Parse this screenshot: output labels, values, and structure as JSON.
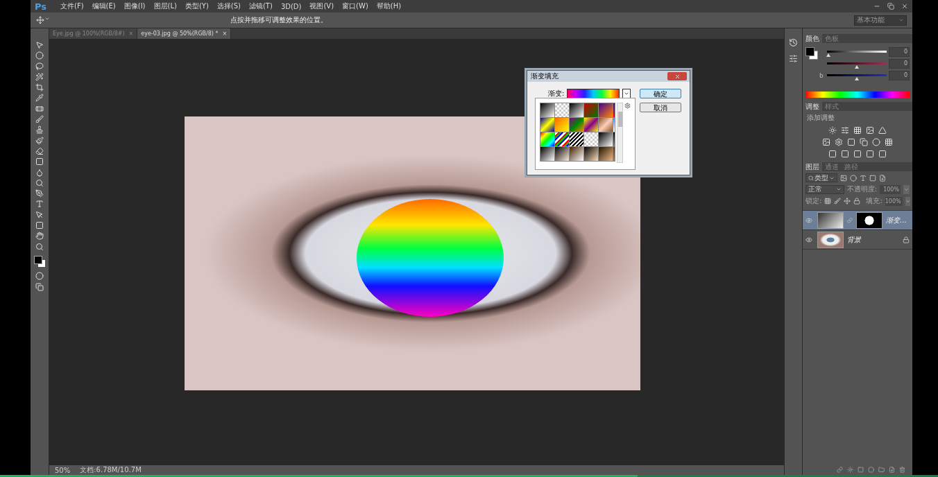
{
  "menu_bar": {
    "app_logo": "Ps",
    "items": [
      "文件(F)",
      "编辑(E)",
      "图像(I)",
      "图层(L)",
      "类型(Y)",
      "选择(S)",
      "滤镜(T)",
      "3D(D)",
      "视图(V)",
      "窗口(W)",
      "帮助(H)"
    ],
    "workspace": "基本功能"
  },
  "options_bar": {
    "hint": "点按并拖移可调整效果的位置。"
  },
  "document_tabs": [
    {
      "label": "Eye.jpg @ 100%(RGB/8#)",
      "selected": false,
      "close": "×"
    },
    {
      "label": "eye-03.jpg @ 50%(RGB/8) *",
      "selected": true,
      "close": "×"
    }
  ],
  "gradient_fill_dialog": {
    "title": "渐变填充",
    "gradient_label": "渐变:",
    "buttons": [
      {
        "label": "确定",
        "default": true
      },
      {
        "label": "取消",
        "default": false
      }
    ]
  },
  "status_bar": {
    "zoom": "50%",
    "doc_info": "文档:6.78M/10.7M"
  },
  "color_panel": {
    "tabs": [
      {
        "label": "颜色",
        "selected": true
      },
      {
        "label": "色板",
        "selected": false
      }
    ],
    "sliders": [
      {
        "value": "0",
        "level": 0.02
      },
      {
        "value": "0",
        "level": 0.5
      },
      {
        "label": "b",
        "value": "0",
        "level": 0.5
      }
    ]
  },
  "adjustments_panel": {
    "tabs": [
      {
        "label": "调整",
        "selected": true
      },
      {
        "label": "样式",
        "selected": false
      }
    ],
    "heading": "添加调整"
  },
  "layers_panel": {
    "tabs": [
      {
        "label": "图层",
        "selected": true
      },
      {
        "label": "通道",
        "selected": false
      },
      {
        "label": "路径",
        "selected": false
      }
    ],
    "filter": "类型",
    "blend_mode": "正常",
    "opacity_label": "不透明度:",
    "opacity": {
      "value": "100%",
      "disabled": true
    },
    "lock_label": "锁定:",
    "fill_label": "填充:",
    "fill": {
      "value": "100%",
      "disabled": true
    },
    "layers": [
      {
        "name": "渐变…",
        "kind": "fill",
        "selected": true,
        "visible": true,
        "locked": false
      },
      {
        "name": "背景",
        "kind": "background",
        "selected": false,
        "visible": true,
        "locked": true
      }
    ]
  },
  "video_progress": {
    "level": 0.68
  }
}
